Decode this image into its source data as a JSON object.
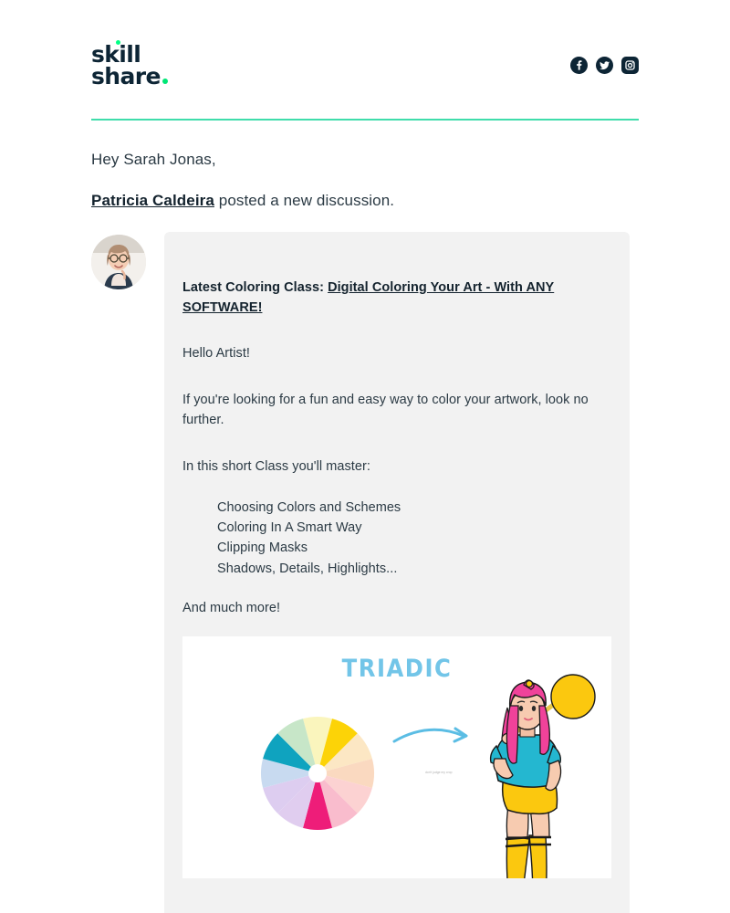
{
  "brand": {
    "logo_line1": "skill",
    "logo_line2": "share",
    "accent_green": "#00e676",
    "navy": "#0d2535",
    "divider_color": "#3fddab"
  },
  "header": {
    "social": [
      {
        "name": "facebook-icon",
        "label": "Facebook"
      },
      {
        "name": "twitter-icon",
        "label": "Twitter"
      },
      {
        "name": "instagram-icon",
        "label": "Instagram"
      }
    ]
  },
  "body": {
    "greeting": "Hey Sarah Jonas,",
    "author": "Patricia Caldeira",
    "posted_suffix": " posted a new discussion."
  },
  "discussion": {
    "title_prefix": "Latest Coloring Class: ",
    "title_link": "Digital Coloring Your Art - With ANY SOFTWARE!",
    "paragraph_1": "Hello Artist!",
    "paragraph_2": "If you're looking for a fun and easy way to color your artwork, look no further.",
    "paragraph_3": "In this short Class you'll master:",
    "list": [
      "Choosing Colors and Schemes",
      "Coloring In A Smart Way",
      "Clipping Masks",
      "Shadows, Details, Highlights..."
    ],
    "paragraph_4": "And much more!"
  },
  "attachment": {
    "title": "TRIADIC",
    "title_color": "#72c5e8",
    "watermark": "don't judge my crop",
    "color_wheel": {
      "segments": 12,
      "colors": [
        "#faf5bd",
        "#fce26a",
        "#fbe3c4",
        "#fad4bb",
        "#fbcfd0",
        "#f5a0c0",
        "#ee1d79",
        "#dbc8ec",
        "#cdb9e8",
        "#c5d6ef",
        "#0fa3bf",
        "#c3e5c6"
      ],
      "highlighted": [
        "#fce26a",
        "#ee1d79",
        "#0fa3bf"
      ]
    },
    "character": {
      "hair": "#f0429a",
      "shirt": "#24b7d0",
      "shorts": "#fbc80f",
      "socks": "#fbc80f",
      "shoes": "#24b7d0",
      "skin": "#f7cbb0",
      "mallet": "#fbc80f"
    },
    "arrow_color": "#5bbde4"
  }
}
